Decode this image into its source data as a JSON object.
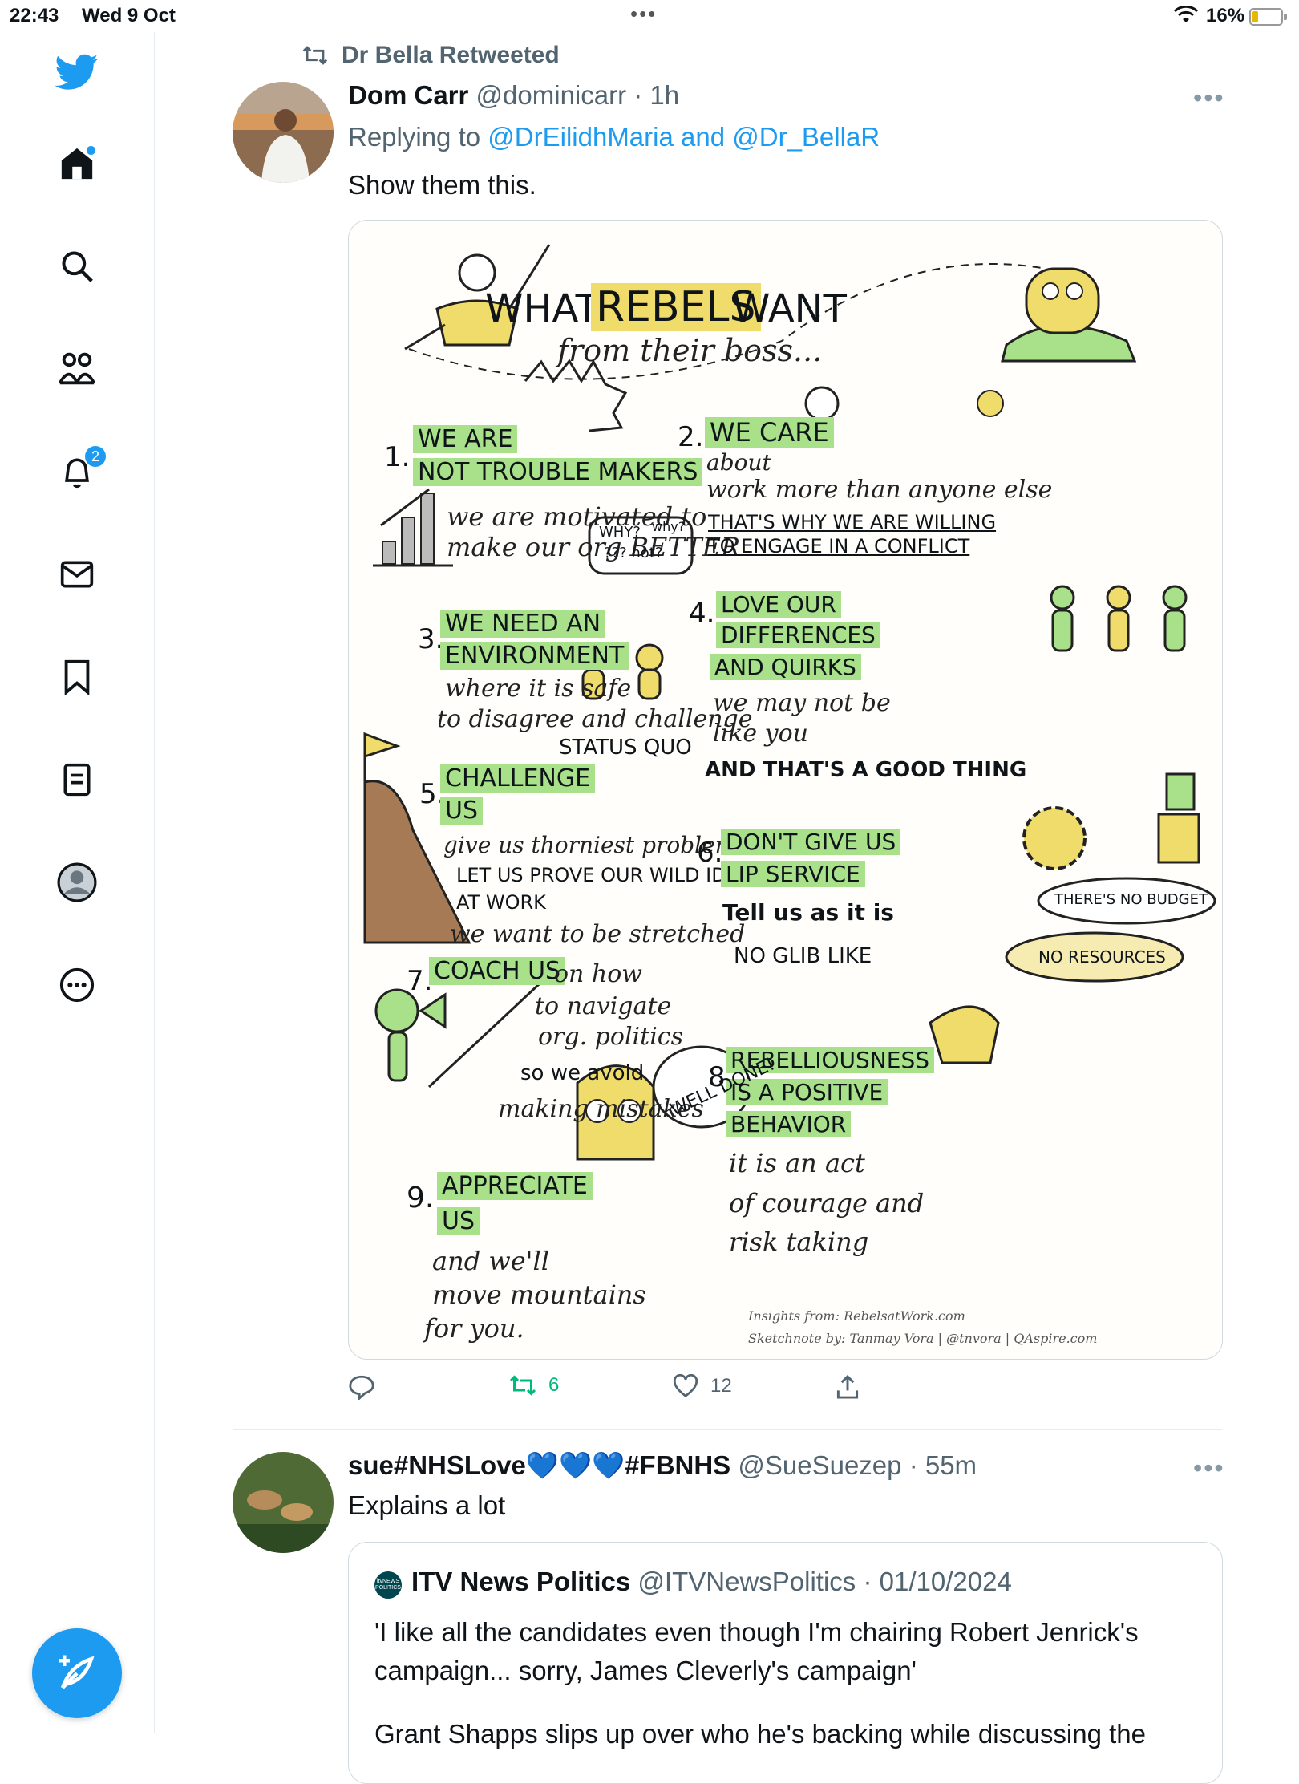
{
  "status": {
    "time": "22:43",
    "date": "Wed 9 Oct",
    "battery": "16%"
  },
  "nav": {
    "notifications_badge": "2"
  },
  "tweet1": {
    "retweeted_by": "Dr Bella Retweeted",
    "author_name": "Dom Carr",
    "handle": "@dominicarr",
    "time": "· 1h",
    "replying_prefix": "Replying to",
    "reply_to_1": "@DrEilidhMaria",
    "reply_and": "and",
    "reply_to_2": "@Dr_BellaR",
    "text": "Show them this.",
    "retweets": "6",
    "likes": "12"
  },
  "sketch": {
    "title_what": "WHAT",
    "title_rebels": "REBELS",
    "title_want": "WANT",
    "subtitle": "from their boss...",
    "n1": "1.",
    "p1a": "WE ARE",
    "p1b": "NOT TROUBLE MAKERS",
    "p1c": "we are motivated to",
    "p1d": "make our org BETTER",
    "n2": "2.",
    "p2a": "WE CARE",
    "p2b": "about",
    "p2c": "work more than anyone else",
    "p2d": "THAT'S WHY WE ARE WILLING",
    "p2e": "TO ENGAGE IN A CONFLICT",
    "why1": "WHY?",
    "why2": "why?",
    "why3": "??? not?",
    "n3": "3.",
    "p3a": "WE NEED AN",
    "p3b": "ENVIRONMENT",
    "p3c": "where it is safe",
    "p3d": "to disagree and challenge",
    "p3e": "STATUS QUO",
    "n4": "4.",
    "p4a": "LOVE OUR",
    "p4b": "DIFFERENCES",
    "p4c": "AND QUIRKS",
    "p4d": "we may not be",
    "p4e": "like you",
    "p4f": "AND THAT'S A GOOD THING",
    "n5": "5.",
    "p5a": "CHALLENGE",
    "p5b": "US",
    "p5c": "give us thorniest problems",
    "p5d": "LET US PROVE OUR WILD IDEAS",
    "p5e": "AT WORK",
    "p5f": "we want to be stretched",
    "n6": "6.",
    "p6a": "DON'T GIVE US",
    "p6b": "LIP SERVICE",
    "p6c": "Tell us as it is",
    "p6d": "NO GLIB LIKE",
    "p6e": "THERE'S NO BUDGET",
    "p6f": "NO RESOURCES",
    "n7": "7.",
    "p7a": "COACH US",
    "p7b": "on how",
    "p7c": "to navigate",
    "p7d": "org. politics",
    "p7e": "so we avoid",
    "p7f": "making mistakes",
    "n8": "8.",
    "p8a": "REBELLIOUSNESS",
    "p8b": "IS A POSITIVE",
    "p8c": "BEHAVIOR",
    "p8d": "it is an act",
    "p8e": "of courage and",
    "p8f": "risk taking",
    "n9": "9.",
    "p9a": "APPRECIATE",
    "p9b": "US",
    "p9c": "and we'll",
    "p9d": "move mountains",
    "p9e": "for you.",
    "well_done": "WELL DONE!",
    "credit1": "Insights from: RebelsatWork.com",
    "credit2": "Sketchnote by: Tanmay Vora | @tnvora | QAspire.com"
  },
  "tweet2": {
    "author_name": "sue#NHSLove💙💙💙#FBNHS",
    "handle": "@SueSuezep",
    "time": "· 55m",
    "text": "Explains a lot",
    "quote": {
      "logo_text": "itvNEWS POLITICS",
      "name": "ITV News Politics",
      "handle": "@ITVNewsPolitics",
      "date": "· 01/10/2024",
      "text": "'I like all the candidates even though I'm chairing Robert Jenrick's campaign... sorry, James Cleverly's campaign'",
      "text2": "Grant Shapps slips up over who he's backing while discussing the"
    }
  }
}
